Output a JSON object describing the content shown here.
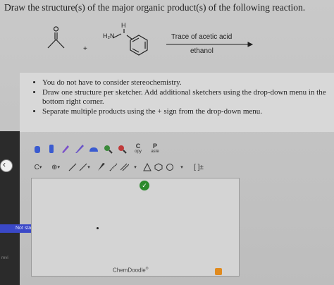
{
  "question": "Draw the structure(s) of the major organic product(s) of the following reaction.",
  "reaction": {
    "plus": "+",
    "amine_group": "H₂N",
    "nh_label": "H",
    "reagent_top": "Trace of acetic acid",
    "reagent_bottom": "ethanol"
  },
  "instructions": [
    "You do not have to consider stereochemistry.",
    "Draw one structure per sketcher. Add additional sketchers using the drop-down menu in the bottom right corner.",
    "Separate multiple products using the + sign from the drop-down menu."
  ],
  "toolbar": {
    "copy_letter": "C",
    "copy_label": "opy",
    "paste_letter": "P",
    "paste_label": "aste",
    "charge_label": "C",
    "bracket_label": "[ ]±"
  },
  "status": {
    "not_started": "Not started",
    "prev": "revi"
  },
  "sketcher": {
    "brand": "ChemDoodle",
    "brand_mark": "®"
  },
  "colors": {
    "check_green": "#2d8a2d",
    "status_blue": "#3a48c7",
    "accent_orange": "#e08a1e"
  }
}
